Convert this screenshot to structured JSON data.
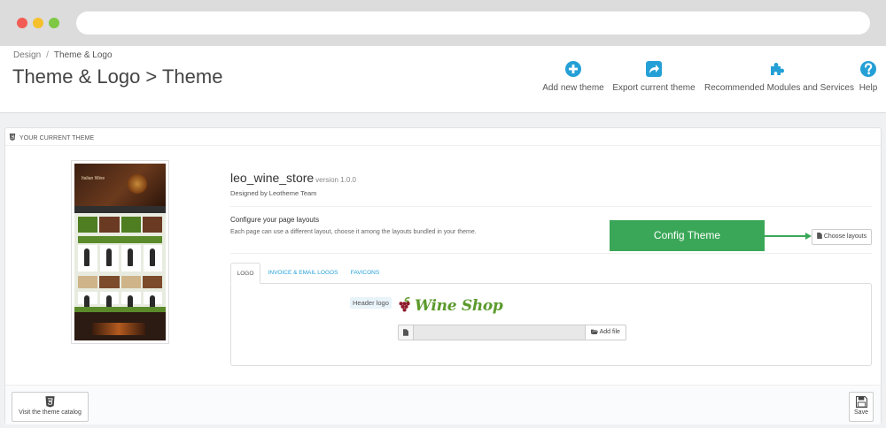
{
  "breadcrumb": {
    "parent": "Design",
    "separator": "/",
    "current": "Theme & Logo"
  },
  "page_title": "Theme & Logo > Theme",
  "toolbar": {
    "add_new_theme": "Add new theme",
    "export_current_theme": "Export current theme",
    "recommended_modules": "Recommended Modules and Services",
    "help": "Help"
  },
  "panel": {
    "heading": "YOUR CURRENT THEME",
    "theme_name": "leo_wine_store",
    "theme_version": "version 1.0.0",
    "designed_by": "Designed by Leotheme Team",
    "layouts_title": "Configure your page layouts",
    "layouts_desc": "Each page can use a different layout, choose it among the layouts bundled in your theme.",
    "config_theme": "Config Theme",
    "choose_layouts": "Choose layouts",
    "thumb_hero_text": "Italian Wine",
    "tabs": [
      "LOGO",
      "INVOICE & EMAIL LOGOS",
      "FAVICONS"
    ],
    "header_logo_label": "Header logo",
    "logo_text": "Wine Shop",
    "add_file": "Add file",
    "visit_catalog": "Visit the theme catalog",
    "save": "Save"
  },
  "colors": {
    "accent_blue": "#25a0d6",
    "config_green": "#3aa758",
    "logo_green": "#5b9a2c"
  },
  "icons": {
    "add_new_theme": "plus-circle-icon",
    "export": "share-arrow-icon",
    "modules": "puzzle-icon",
    "help": "question-circle-icon",
    "catalog": "html5-icon",
    "save": "floppy-disk-icon"
  }
}
